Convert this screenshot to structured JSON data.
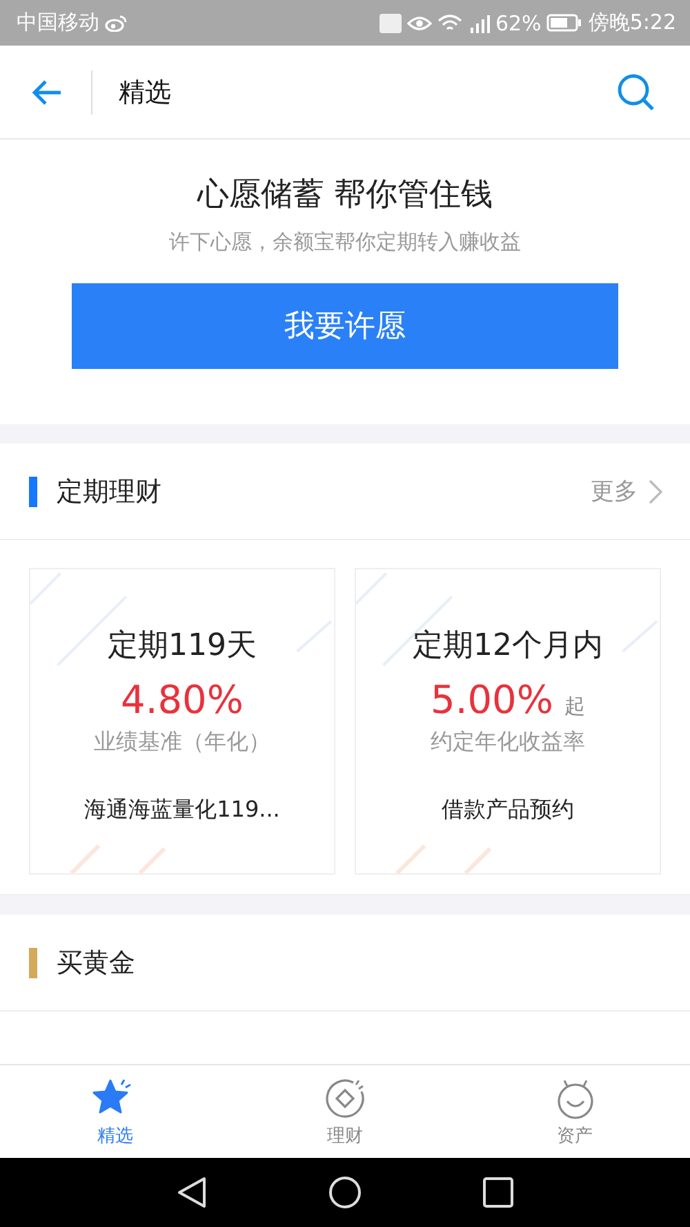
{
  "status_bar": {
    "carrier": "中国移动",
    "battery": "62%",
    "time": "傍晚5:22"
  },
  "header": {
    "title": "精选"
  },
  "wish": {
    "title": "心愿储蓄 帮你管住钱",
    "subtitle": "许下心愿，余额宝帮你定期转入赚收益",
    "button": "我要许愿"
  },
  "sections": [
    {
      "title": "定期理财",
      "color": "#1677ff",
      "more": "更多",
      "cards": [
        {
          "title": "定期119天",
          "rate": "4.80%",
          "rate_label": "业绩基准（年化）",
          "product": "海通海蓝量化119..."
        },
        {
          "title": "定期12个月内",
          "rate": "5.00%",
          "suffix": "起",
          "rate_label": "约定年化收益率",
          "product": "借款产品预约"
        }
      ]
    },
    {
      "title": "买黄金",
      "color": "#d4a959"
    }
  ],
  "tabs": [
    {
      "label": "精选",
      "selected": true,
      "kind": "star"
    },
    {
      "label": "理财",
      "selected": false,
      "kind": "coin"
    },
    {
      "label": "资产",
      "selected": false,
      "kind": "face"
    }
  ]
}
